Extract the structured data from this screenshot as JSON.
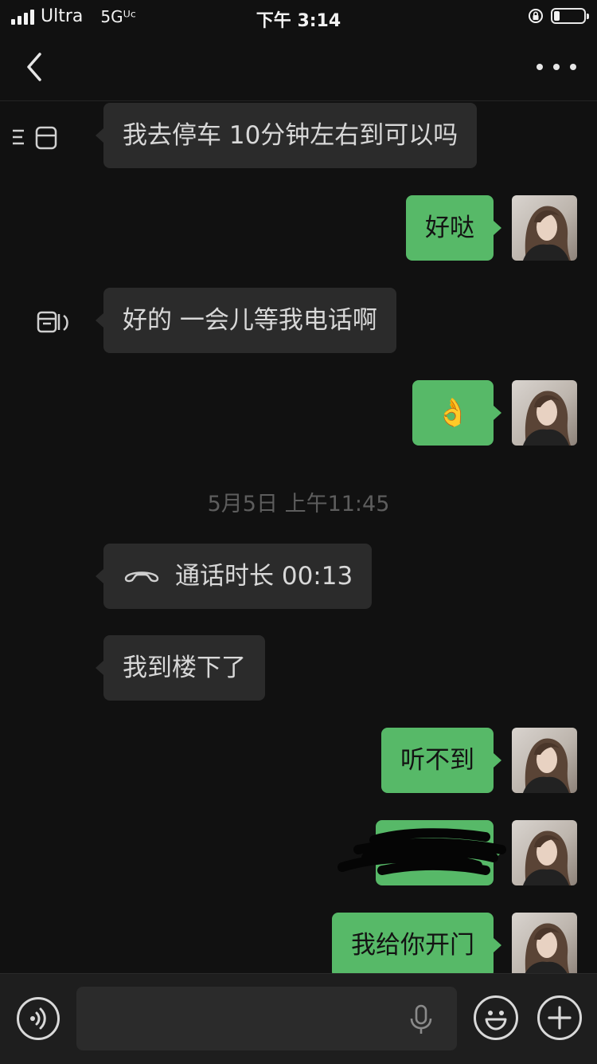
{
  "status_bar": {
    "carrier": "Ultra",
    "network": "5Gᵁᶜ",
    "time": "下午 3:14",
    "battery_level": 0.2
  },
  "nav": {
    "back_icon": "chevron-left-icon",
    "more_icon": "more-dots-icon"
  },
  "messages": [
    {
      "side": "in",
      "text": "我去停车 10分钟左右到可以吗"
    },
    {
      "side": "out",
      "text": "好哒"
    },
    {
      "side": "in",
      "text": "好的 一会儿等我电话啊"
    },
    {
      "side": "out",
      "text": "👌"
    },
    {
      "side": "in",
      "type": "call",
      "text": "通话时长 00:13"
    },
    {
      "side": "in",
      "text": "我到楼下了"
    },
    {
      "side": "out",
      "text": "听不到"
    },
    {
      "side": "out",
      "text": "",
      "redacted": true
    },
    {
      "side": "out",
      "text": "我给你开门"
    }
  ],
  "timestamp": "5月5日 上午11:45",
  "input_bar": {
    "voice_icon": "voice-icon",
    "mic_icon": "microphone-icon",
    "emoji_icon": "emoji-icon",
    "plus_icon": "plus-icon",
    "input_value": ""
  },
  "colors": {
    "background": "#111111",
    "incoming_bubble": "#2b2b2b",
    "outgoing_bubble": "#57b968",
    "timestamp_text": "#5d5d5d"
  }
}
